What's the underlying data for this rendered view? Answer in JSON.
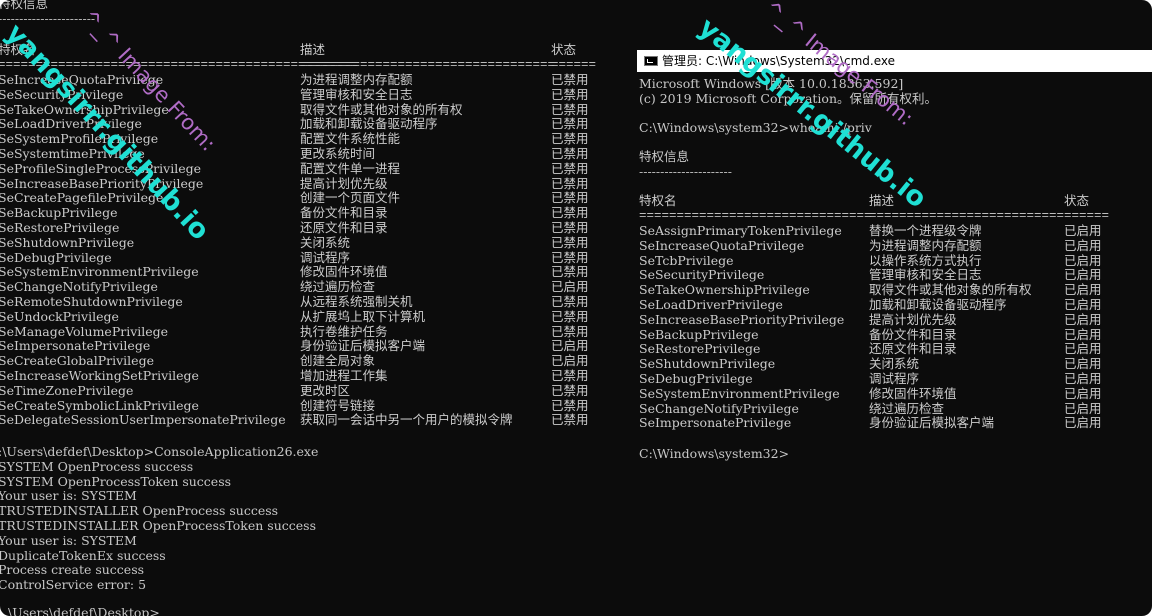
{
  "left": {
    "section_title": "特权信息",
    "section_underline": "-----------------------",
    "headers": {
      "name": "特权名",
      "desc": "描述",
      "state": "状态"
    },
    "header_rules": {
      "name": "================================================",
      "desc": "==================================",
      "state": "======"
    },
    "privileges": [
      {
        "name": "SeIncreaseQuotaPrivilege",
        "desc": "为进程调整内存配额",
        "state": "已禁用"
      },
      {
        "name": "SeSecurityPrivilege",
        "desc": "管理审核和安全日志",
        "state": "已禁用"
      },
      {
        "name": "SeTakeOwnershipPrivilege",
        "desc": "取得文件或其他对象的所有权",
        "state": "已禁用"
      },
      {
        "name": "SeLoadDriverPrivilege",
        "desc": "加载和卸载设备驱动程序",
        "state": "已禁用"
      },
      {
        "name": "SeSystemProfilePrivilege",
        "desc": "配置文件系统性能",
        "state": "已禁用"
      },
      {
        "name": "SeSystemtimePrivilege",
        "desc": "更改系统时间",
        "state": "已禁用"
      },
      {
        "name": "SeProfileSingleProcessPrivilege",
        "desc": "配置文件单一进程",
        "state": "已禁用"
      },
      {
        "name": "SeIncreaseBasePriorityPrivilege",
        "desc": "提高计划优先级",
        "state": "已禁用"
      },
      {
        "name": "SeCreatePagefilePrivilege",
        "desc": "创建一个页面文件",
        "state": "已禁用"
      },
      {
        "name": "SeBackupPrivilege",
        "desc": "备份文件和目录",
        "state": "已禁用"
      },
      {
        "name": "SeRestorePrivilege",
        "desc": "还原文件和目录",
        "state": "已禁用"
      },
      {
        "name": "SeShutdownPrivilege",
        "desc": "关闭系统",
        "state": "已禁用"
      },
      {
        "name": "SeDebugPrivilege",
        "desc": "调试程序",
        "state": "已禁用"
      },
      {
        "name": "SeSystemEnvironmentPrivilege",
        "desc": "修改固件环境值",
        "state": "已禁用"
      },
      {
        "name": "SeChangeNotifyPrivilege",
        "desc": "绕过遍历检查",
        "state": "已启用"
      },
      {
        "name": "SeRemoteShutdownPrivilege",
        "desc": "从远程系统强制关机",
        "state": "已禁用"
      },
      {
        "name": "SeUndockPrivilege",
        "desc": "从扩展坞上取下计算机",
        "state": "已禁用"
      },
      {
        "name": "SeManageVolumePrivilege",
        "desc": "执行卷维护任务",
        "state": "已禁用"
      },
      {
        "name": "SeImpersonatePrivilege",
        "desc": "身份验证后模拟客户端",
        "state": "已启用"
      },
      {
        "name": "SeCreateGlobalPrivilege",
        "desc": "创建全局对象",
        "state": "已启用"
      },
      {
        "name": "SeIncreaseWorkingSetPrivilege",
        "desc": "增加进程工作集",
        "state": "已禁用"
      },
      {
        "name": "SeTimeZonePrivilege",
        "desc": "更改时区",
        "state": "已禁用"
      },
      {
        "name": "SeCreateSymbolicLinkPrivilege",
        "desc": "创建符号链接",
        "state": "已禁用"
      },
      {
        "name": "SeDelegateSessionUserImpersonatePrivilege",
        "desc": "获取同一会话中另一个用户的模拟令牌",
        "state": "已禁用"
      }
    ],
    "output_lines": [
      ":\\Users\\defdef\\Desktop>ConsoleApplication26.exe",
      "SYSTEM OpenProcess success",
      "SYSTEM OpenProcessToken success",
      "Your user is: SYSTEM",
      "TRUSTEDINSTALLER OpenProcess success",
      "TRUSTEDINSTALLER OpenProcessToken success",
      "Your user is: SYSTEM",
      "DuplicateTokenEx success",
      "Process create success",
      "ControlService error: 5"
    ],
    "last_prompt": "\\Users\\defdef\\Desktop>"
  },
  "right": {
    "window_title": "管理员: C:\\Windows\\System32\\cmd.exe",
    "banner_line1": "Microsoft Windows [版本 10.0.18363.592]",
    "banner_line2": "(c) 2019 Microsoft Corporation。保留所有权利。",
    "command_line": "C:\\Windows\\system32>whoami /priv",
    "section_title": "特权信息",
    "section_underline": "----------------------",
    "headers": {
      "name": "特权名",
      "desc": "描述",
      "state": "状态"
    },
    "header_rules": {
      "name": "===============================",
      "desc": "==========================",
      "state": "======"
    },
    "privileges": [
      {
        "name": "SeAssignPrimaryTokenPrivilege",
        "desc": "替换一个进程级令牌",
        "state": "已启用"
      },
      {
        "name": "SeIncreaseQuotaPrivilege",
        "desc": "为进程调整内存配额",
        "state": "已启用"
      },
      {
        "name": "SeTcbPrivilege",
        "desc": "以操作系统方式执行",
        "state": "已启用"
      },
      {
        "name": "SeSecurityPrivilege",
        "desc": "管理审核和安全日志",
        "state": "已启用"
      },
      {
        "name": "SeTakeOwnershipPrivilege",
        "desc": "取得文件或其他对象的所有权",
        "state": "已启用"
      },
      {
        "name": "SeLoadDriverPrivilege",
        "desc": "加载和卸载设备驱动程序",
        "state": "已启用"
      },
      {
        "name": "SeIncreaseBasePriorityPrivilege",
        "desc": "提高计划优先级",
        "state": "已启用"
      },
      {
        "name": "SeBackupPrivilege",
        "desc": "备份文件和目录",
        "state": "已启用"
      },
      {
        "name": "SeRestorePrivilege",
        "desc": "还原文件和目录",
        "state": "已启用"
      },
      {
        "name": "SeShutdownPrivilege",
        "desc": "关闭系统",
        "state": "已启用"
      },
      {
        "name": "SeDebugPrivilege",
        "desc": "调试程序",
        "state": "已启用"
      },
      {
        "name": "SeSystemEnvironmentPrivilege",
        "desc": "修改固件环境值",
        "state": "已启用"
      },
      {
        "name": "SeChangeNotifyPrivilege",
        "desc": "绕过遍历检查",
        "state": "已启用"
      },
      {
        "name": "SeImpersonatePrivilege",
        "desc": "身份验证后模拟客户端",
        "state": "已启用"
      }
    ],
    "final_prompt": "C:\\Windows\\system32>"
  },
  "watermark": {
    "main_text": "yangsirrr.github.io",
    "sub_text": "^_^ Image From:"
  },
  "colors": {
    "console_bg": "#0c0c0c",
    "console_text": "#cccccc",
    "watermark_main": "#1fe0d4",
    "watermark_sub": "#b06cc6"
  }
}
